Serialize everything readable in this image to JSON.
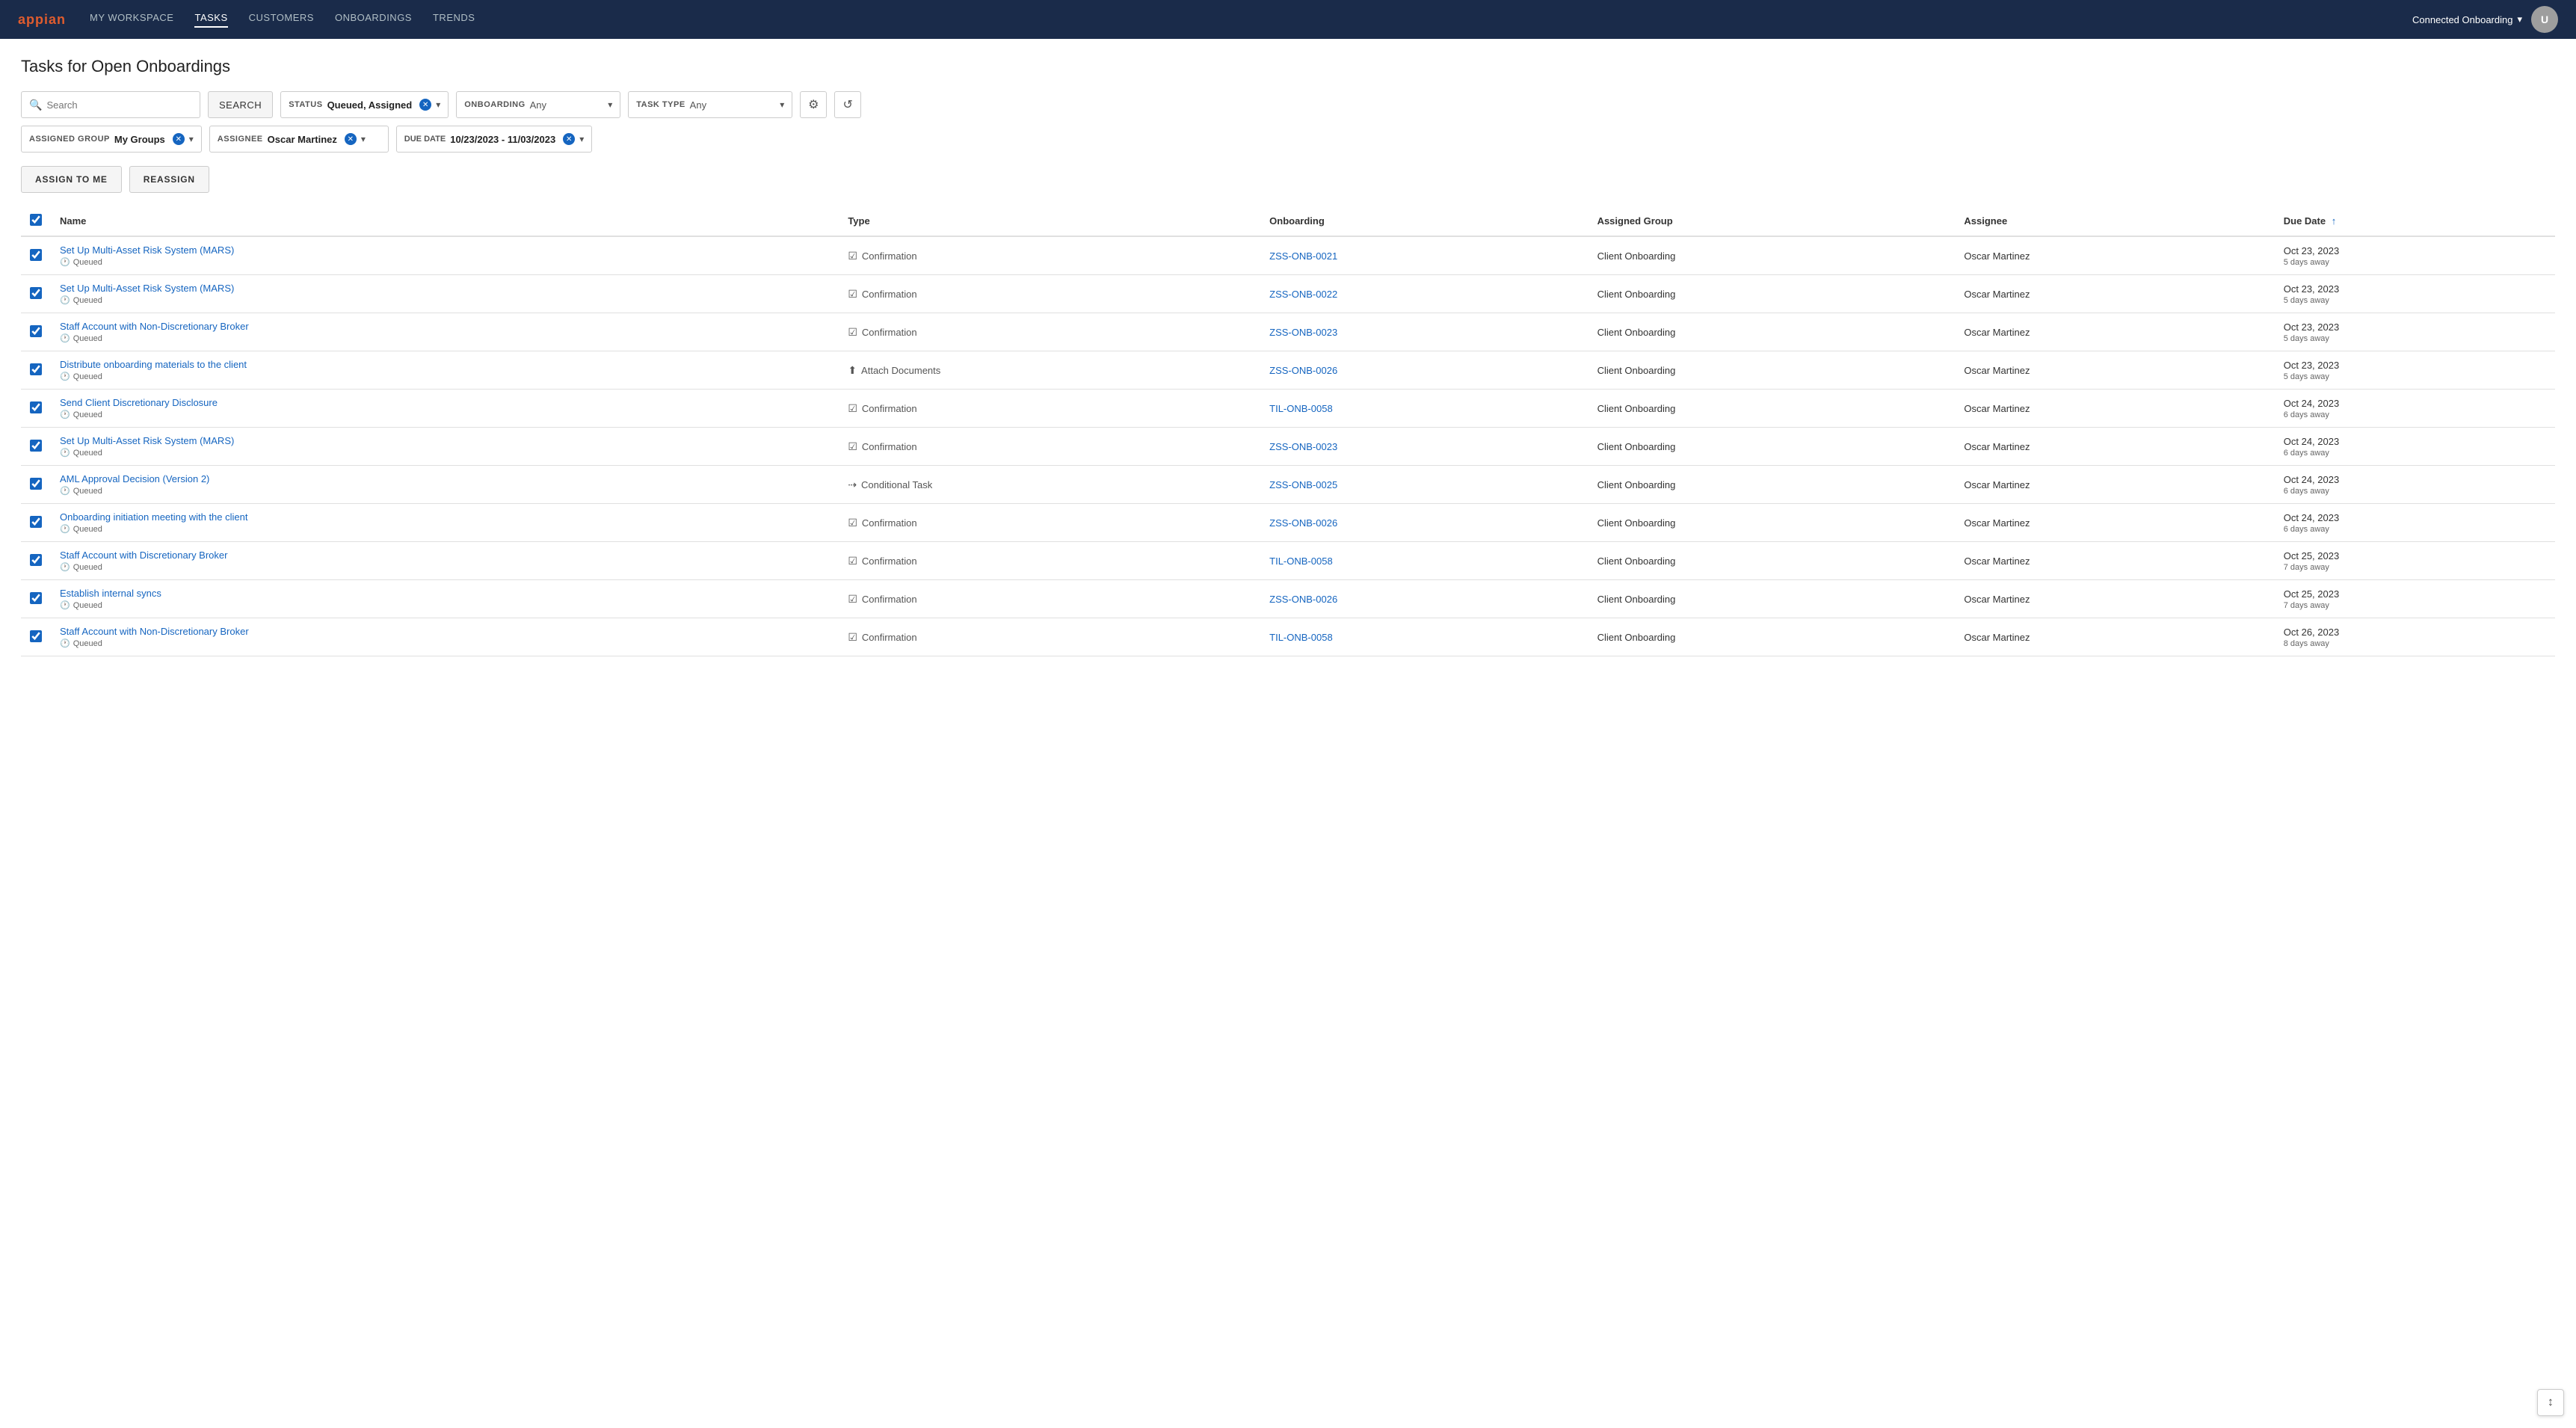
{
  "nav": {
    "logo": "appian",
    "links": [
      {
        "label": "MY WORKSPACE",
        "active": false
      },
      {
        "label": "TASKS",
        "active": true
      },
      {
        "label": "CUSTOMERS",
        "active": false
      },
      {
        "label": "ONBOARDINGS",
        "active": false
      },
      {
        "label": "TRENDS",
        "active": false
      }
    ],
    "workspace": "Connected Onboarding"
  },
  "page": {
    "title": "Tasks for Open Onboardings"
  },
  "filters": {
    "search_placeholder": "Search",
    "search_btn": "SEARCH",
    "status_label": "STATUS",
    "status_value": "Queued, Assigned",
    "onboarding_label": "ONBOARDING",
    "onboarding_value": "Any",
    "task_type_label": "TASK TYPE",
    "task_type_value": "Any",
    "assigned_group_label": "ASSIGNED GROUP",
    "assigned_group_value": "My Groups",
    "assignee_label": "ASSIGNEE",
    "assignee_value": "Oscar Martinez",
    "due_date_label": "DUE DATE",
    "due_date_value": "10/23/2023 - 11/03/2023"
  },
  "actions": {
    "assign_to_me": "ASSIGN TO ME",
    "reassign": "REASSIGN"
  },
  "table": {
    "columns": [
      {
        "label": "Name",
        "key": "name"
      },
      {
        "label": "Type",
        "key": "type"
      },
      {
        "label": "Onboarding",
        "key": "onboarding"
      },
      {
        "label": "Assigned Group",
        "key": "assigned_group"
      },
      {
        "label": "Assignee",
        "key": "assignee"
      },
      {
        "label": "Due Date",
        "key": "due_date"
      }
    ],
    "rows": [
      {
        "checked": true,
        "name": "Set Up Multi-Asset Risk System (MARS)",
        "status": "Queued",
        "type": "Confirmation",
        "type_icon": "✓",
        "onboarding": "ZSS-ONB-0021",
        "assigned_group": "Client Onboarding",
        "assignee": "Oscar Martinez",
        "due_date": "Oct 23, 2023",
        "due_date_sub": "5 days away"
      },
      {
        "checked": true,
        "name": "Set Up Multi-Asset Risk System (MARS)",
        "status": "Queued",
        "type": "Confirmation",
        "type_icon": "✓",
        "onboarding": "ZSS-ONB-0022",
        "assigned_group": "Client Onboarding",
        "assignee": "Oscar Martinez",
        "due_date": "Oct 23, 2023",
        "due_date_sub": "5 days away"
      },
      {
        "checked": true,
        "name": "Staff Account with Non-Discretionary Broker",
        "status": "Queued",
        "type": "Confirmation",
        "type_icon": "✓",
        "onboarding": "ZSS-ONB-0023",
        "assigned_group": "Client Onboarding",
        "assignee": "Oscar Martinez",
        "due_date": "Oct 23, 2023",
        "due_date_sub": "5 days away"
      },
      {
        "checked": true,
        "name": "Distribute onboarding materials to the client",
        "status": "Queued",
        "type": "Attach Documents",
        "type_icon": "⬆",
        "onboarding": "ZSS-ONB-0026",
        "assigned_group": "Client Onboarding",
        "assignee": "Oscar Martinez",
        "due_date": "Oct 23, 2023",
        "due_date_sub": "5 days away"
      },
      {
        "checked": true,
        "name": "Send Client Discretionary Disclosure",
        "status": "Queued",
        "type": "Confirmation",
        "type_icon": "✓",
        "onboarding": "TIL-ONB-0058",
        "assigned_group": "Client Onboarding",
        "assignee": "Oscar Martinez",
        "due_date": "Oct 24, 2023",
        "due_date_sub": "6 days away"
      },
      {
        "checked": true,
        "name": "Set Up Multi-Asset Risk System (MARS)",
        "status": "Queued",
        "type": "Confirmation",
        "type_icon": "✓",
        "onboarding": "ZSS-ONB-0023",
        "assigned_group": "Client Onboarding",
        "assignee": "Oscar Martinez",
        "due_date": "Oct 24, 2023",
        "due_date_sub": "6 days away"
      },
      {
        "checked": true,
        "name": "AML Approval Decision (Version 2)",
        "status": "Queued",
        "type": "Conditional Task",
        "type_icon": "⇢",
        "onboarding": "ZSS-ONB-0025",
        "assigned_group": "Client Onboarding",
        "assignee": "Oscar Martinez",
        "due_date": "Oct 24, 2023",
        "due_date_sub": "6 days away"
      },
      {
        "checked": true,
        "name": "Onboarding initiation meeting with the client",
        "status": "Queued",
        "type": "Confirmation",
        "type_icon": "✓",
        "onboarding": "ZSS-ONB-0026",
        "assigned_group": "Client Onboarding",
        "assignee": "Oscar Martinez",
        "due_date": "Oct 24, 2023",
        "due_date_sub": "6 days away"
      },
      {
        "checked": true,
        "name": "Staff Account with Discretionary Broker",
        "status": "Queued",
        "type": "Confirmation",
        "type_icon": "✓",
        "onboarding": "TIL-ONB-0058",
        "assigned_group": "Client Onboarding",
        "assignee": "Oscar Martinez",
        "due_date": "Oct 25, 2023",
        "due_date_sub": "7 days away"
      },
      {
        "checked": true,
        "name": "Establish internal syncs",
        "status": "Queued",
        "type": "Confirmation",
        "type_icon": "✓",
        "onboarding": "ZSS-ONB-0026",
        "assigned_group": "Client Onboarding",
        "assignee": "Oscar Martinez",
        "due_date": "Oct 25, 2023",
        "due_date_sub": "7 days away"
      },
      {
        "checked": true,
        "name": "Staff Account with Non-Discretionary Broker",
        "status": "Queued",
        "type": "Confirmation",
        "type_icon": "✓",
        "onboarding": "TIL-ONB-0058",
        "assigned_group": "Client Onboarding",
        "assignee": "Oscar Martinez",
        "due_date": "Oct 26, 2023",
        "due_date_sub": "8 days away"
      }
    ]
  },
  "icons": {
    "search": "🔍",
    "clock": "🕐",
    "filter": "⚙",
    "refresh": "↺",
    "sort_up": "↑",
    "chevron_down": "▾",
    "scroll": "↕"
  }
}
